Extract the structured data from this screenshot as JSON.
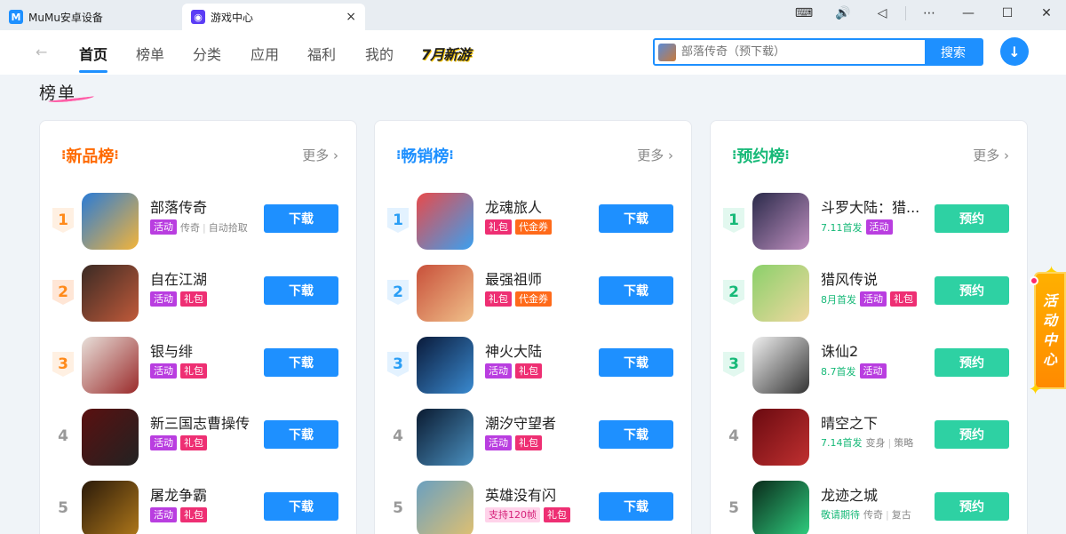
{
  "tabs": [
    {
      "label": "MuMu安卓设备",
      "icon": "mumu-icon",
      "color": "#1e90ff"
    },
    {
      "label": "游戏中心",
      "icon": "gamepad-icon",
      "color": "#5b3df5",
      "close": "×"
    }
  ],
  "window_controls": [
    "⌨",
    "🔊",
    "◁",
    "⋯",
    "—",
    "☐",
    "✕"
  ],
  "nav": {
    "back": "←",
    "items": [
      "首页",
      "榜单",
      "分类",
      "应用",
      "福利",
      "我的"
    ],
    "active": "首页",
    "promo": "7月新游"
  },
  "search": {
    "placeholder": "部落传奇（预下载）",
    "button": "搜索"
  },
  "download_icon": "↓",
  "section": {
    "title": "榜单"
  },
  "float": {
    "chars": [
      "活",
      "动",
      "中",
      "心"
    ],
    "star": "✦"
  },
  "lists": [
    {
      "title": "新品榜",
      "title_color": "#ff6a00",
      "deco_left": "⁝",
      "deco_right": "⁝",
      "more": "更多 ›",
      "rows": [
        {
          "rank": "1",
          "name": "部落传奇",
          "tags": [
            {
              "t": "活动",
              "c": "purple"
            }
          ],
          "meta": [
            "传奇",
            "自动拾取"
          ],
          "button": "下载",
          "icon_colors": [
            "#2a7bd6",
            "#f3b43a"
          ]
        },
        {
          "rank": "2",
          "name": "自在江湖",
          "tags": [
            {
              "t": "活动",
              "c": "purple"
            },
            {
              "t": "礼包",
              "c": "pink"
            }
          ],
          "meta": [],
          "button": "下载",
          "icon_colors": [
            "#3a2a24",
            "#c15a3a"
          ]
        },
        {
          "rank": "3",
          "name": "银与绯",
          "tags": [
            {
              "t": "活动",
              "c": "purple"
            },
            {
              "t": "礼包",
              "c": "pink"
            }
          ],
          "meta": [],
          "button": "下载",
          "icon_colors": [
            "#e8e0da",
            "#9a2a2a"
          ]
        },
        {
          "rank": "4",
          "name": "新三国志曹操传",
          "tags": [
            {
              "t": "活动",
              "c": "purple"
            },
            {
              "t": "礼包",
              "c": "pink"
            }
          ],
          "meta": [],
          "button": "下载",
          "icon_colors": [
            "#5a1010",
            "#222"
          ]
        },
        {
          "rank": "5",
          "name": "屠龙争霸",
          "tags": [
            {
              "t": "活动",
              "c": "purple"
            },
            {
              "t": "礼包",
              "c": "pink"
            }
          ],
          "meta": [],
          "button": "下载",
          "icon_colors": [
            "#2a1a0a",
            "#b0781a"
          ]
        }
      ]
    },
    {
      "title": "畅销榜",
      "title_color": "#1e90ff",
      "deco_left": "⁝",
      "deco_right": "⁝",
      "more": "更多 ›",
      "rows": [
        {
          "rank": "1",
          "name": "龙魂旅人",
          "tags": [
            {
              "t": "礼包",
              "c": "pink"
            },
            {
              "t": "代金券",
              "c": "orange"
            }
          ],
          "meta": [],
          "button": "下载",
          "icon_colors": [
            "#e84a4a",
            "#3aa0f0"
          ]
        },
        {
          "rank": "2",
          "name": "最强祖师",
          "tags": [
            {
              "t": "礼包",
              "c": "pink"
            },
            {
              "t": "代金券",
              "c": "orange"
            }
          ],
          "meta": [],
          "button": "下载",
          "icon_colors": [
            "#c8503a",
            "#f0c08a"
          ]
        },
        {
          "rank": "3",
          "name": "神火大陆",
          "tags": [
            {
              "t": "活动",
              "c": "purple"
            },
            {
              "t": "礼包",
              "c": "pink"
            }
          ],
          "meta": [],
          "button": "下载",
          "icon_colors": [
            "#0a1a3a",
            "#3a8ad0"
          ]
        },
        {
          "rank": "4",
          "name": "潮汐守望者",
          "tags": [
            {
              "t": "活动",
              "c": "purple"
            },
            {
              "t": "礼包",
              "c": "pink"
            }
          ],
          "meta": [],
          "button": "下载",
          "icon_colors": [
            "#0a1a30",
            "#4a90c0"
          ]
        },
        {
          "rank": "5",
          "name": "英雄没有闪",
          "tags": [
            {
              "t": "支持120帧",
              "c": "pinklight"
            },
            {
              "t": "礼包",
              "c": "pink"
            }
          ],
          "meta": [],
          "button": "下载",
          "icon_colors": [
            "#6aa0c0",
            "#e0c070"
          ]
        }
      ]
    },
    {
      "title": "预约榜",
      "title_color": "#17b978",
      "deco_left": "⁝",
      "deco_right": "⁝",
      "more": "更多 ›",
      "rows": [
        {
          "rank": "1",
          "name": "斗罗大陆：猎...",
          "tags": [
            {
              "t": "活动",
              "c": "purple"
            }
          ],
          "date": "7.11首发",
          "meta": [],
          "button": "预约",
          "icon_colors": [
            "#2a2a4a",
            "#c090c0"
          ]
        },
        {
          "rank": "2",
          "name": "猎风传说",
          "tags": [
            {
              "t": "活动",
              "c": "purple"
            },
            {
              "t": "礼包",
              "c": "pink"
            }
          ],
          "date": "8月首发",
          "meta": [],
          "button": "预约",
          "icon_colors": [
            "#8ad06a",
            "#f0d8a0"
          ]
        },
        {
          "rank": "3",
          "name": "诛仙2",
          "tags": [
            {
              "t": "活动",
              "c": "purple"
            }
          ],
          "date": "8.7首发",
          "meta": [],
          "button": "预约",
          "icon_colors": [
            "#f0f0f0",
            "#333"
          ]
        },
        {
          "rank": "4",
          "name": "晴空之下",
          "tags": [],
          "date": "7.14首发",
          "meta": [
            "变身",
            "策略"
          ],
          "button": "预约",
          "icon_colors": [
            "#6a0a10",
            "#c03030"
          ]
        },
        {
          "rank": "5",
          "name": "龙迹之城",
          "tags": [],
          "date": "敬请期待",
          "meta": [
            "传奇",
            "复古"
          ],
          "button": "预约",
          "icon_colors": [
            "#0a2a1a",
            "#30d080"
          ]
        }
      ]
    }
  ]
}
